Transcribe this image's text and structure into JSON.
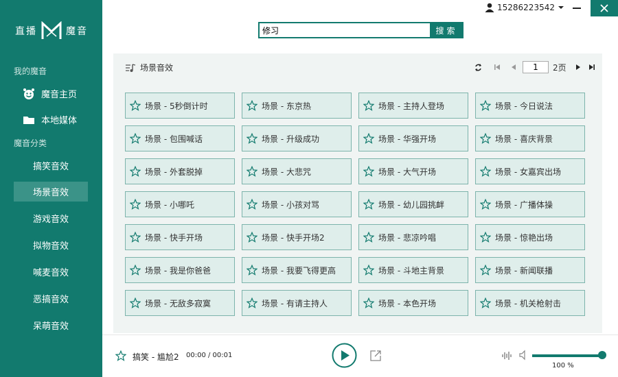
{
  "app": {
    "logo_left": "直播",
    "logo_right": "魔音",
    "logo_mark": "M"
  },
  "sidebar": {
    "section1": "我的魔音",
    "items_top": [
      {
        "label": "魔音主页",
        "icon": "smiley-icon"
      },
      {
        "label": "本地媒体",
        "icon": "folder-icon"
      }
    ],
    "section2": "魔音分类",
    "categories": [
      {
        "label": "搞笑音效",
        "active": false
      },
      {
        "label": "场景音效",
        "active": true
      },
      {
        "label": "游戏音效",
        "active": false
      },
      {
        "label": "拟物音效",
        "active": false
      },
      {
        "label": "喊麦音效",
        "active": false
      },
      {
        "label": "恶搞音效",
        "active": false
      },
      {
        "label": "呆萌音效",
        "active": false
      }
    ]
  },
  "header": {
    "search_value": "修习",
    "search_button": "搜索",
    "user_phone": "15286223542"
  },
  "content": {
    "section_title": "场景音效",
    "pager": {
      "current": "1",
      "total": "2页"
    },
    "tiles": [
      "场景 - 5秒倒计时",
      "场景 - 东京热",
      "场景 - 主持人登场",
      "场景 - 今日说法",
      "场景 - 包围喊话",
      "场景 - 升级成功",
      "场景 - 华强开场",
      "场景 - 喜庆背景",
      "场景 - 外套脱掉",
      "场景 - 大悲咒",
      "场景 - 大气开场",
      "场景 - 女嘉宾出场",
      "场景 - 小哪吒",
      "场景 - 小孩对骂",
      "场景 - 幼儿园挑衅",
      "场景 - 广播体操",
      "场景 - 快手开场",
      "场景 - 快手开场2",
      "场景 - 悲凉吟唱",
      "场景 - 惊艳出场",
      "场景 - 我是你爸爸",
      "场景 - 我要飞得更高",
      "场景 - 斗地主背景",
      "场景 - 新闻联播",
      "场景 - 无敌多寂寞",
      "场景 - 有请主持人",
      "场景 - 本色开场",
      "场景 - 机关枪射击"
    ]
  },
  "player": {
    "now_playing": "搞笑 - 尴尬2",
    "time": "00:00 / 00:01",
    "volume": 1.0,
    "volume_label": "100 %"
  },
  "colors": {
    "primary": "#127a6e",
    "active_item": "#3b9388",
    "tile_bg": "#dfeeeb",
    "tile_border": "#7cb3ab",
    "content_bg": "#f0f4f3"
  }
}
